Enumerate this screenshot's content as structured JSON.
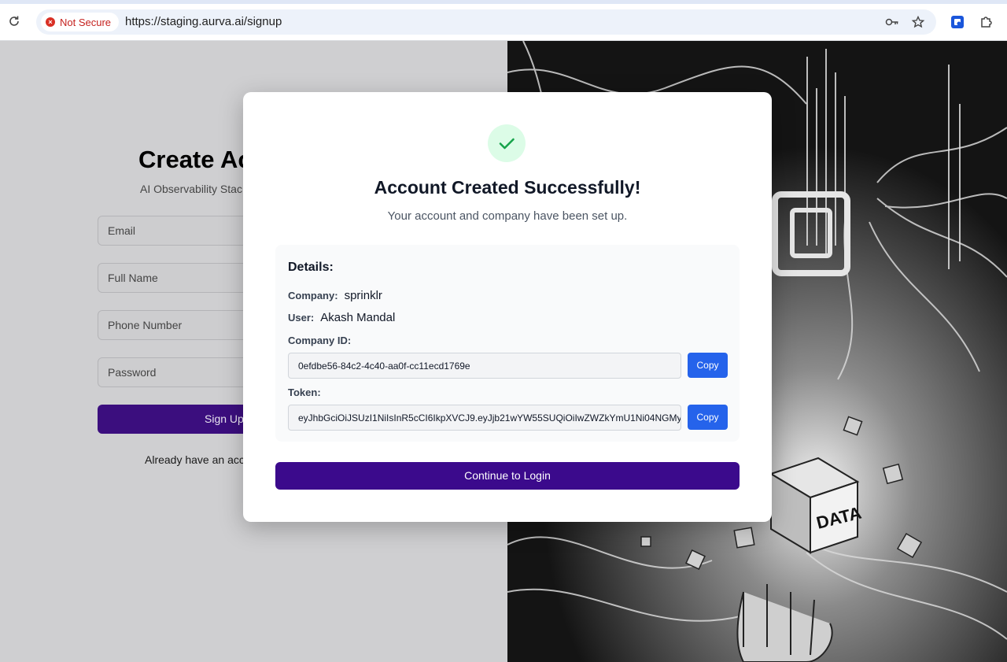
{
  "browser": {
    "security_label": "Not Secure",
    "url": "https://staging.aurva.ai/signup"
  },
  "signup_form": {
    "title": "Create Ac",
    "subtitle": "AI Observability Stac",
    "fields": [
      {
        "placeholder": "Email"
      },
      {
        "placeholder": "Full Name"
      },
      {
        "placeholder": "Phone Number"
      },
      {
        "placeholder": "Password"
      }
    ],
    "submit_label": "Sign Up",
    "login_prompt": "Already have an acc"
  },
  "artwork": {
    "box_label": "DATA"
  },
  "modal": {
    "title": "Account Created Successfully!",
    "subtitle": "Your account and company have been set up.",
    "details_heading": "Details:",
    "company_label": "Company:",
    "company_value": "sprinklr",
    "user_label": "User:",
    "user_value": "Akash Mandal",
    "company_id_label": "Company ID:",
    "company_id_value": "0efdbe56-84c2-4c40-aa0f-cc11ecd1769e",
    "token_label": "Token:",
    "token_value": "eyJhbGciOiJSUzI1NiIsInR5cCI6IkpXVCJ9.eyJjb21wYW55SUQiOiIwZWZkYmU1Ni04NGMy",
    "copy_label": "Copy",
    "continue_label": "Continue to Login"
  },
  "colors": {
    "accent": "#3b0a8c",
    "copy_button": "#2563eb",
    "success": "#16a34a"
  }
}
